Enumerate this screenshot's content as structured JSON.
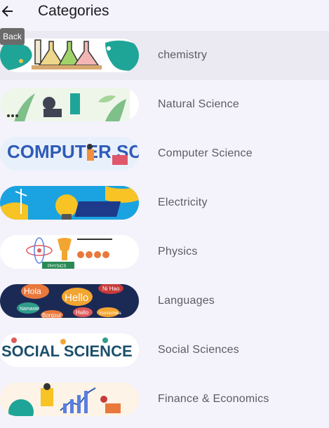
{
  "appbar": {
    "title": "Categories",
    "back_tooltip": "Back"
  },
  "categories": [
    {
      "label": "chemistry",
      "selected": true
    },
    {
      "label": "Natural Science"
    },
    {
      "label": "Computer Science",
      "banner_text": "COMPUTER SCIENCE"
    },
    {
      "label": "Electricity"
    },
    {
      "label": "Physics",
      "banner_text": "PHYSICS"
    },
    {
      "label": "Languages",
      "banner_words": [
        "Hola",
        "Hello",
        "Ni Hao",
        "Namaste",
        "Hallo",
        "Bonjour",
        "Konnichiwa"
      ]
    },
    {
      "label": "Social Sciences",
      "banner_text": "SOCIAL SCIENCE"
    },
    {
      "label": "Finance & Economics"
    }
  ]
}
